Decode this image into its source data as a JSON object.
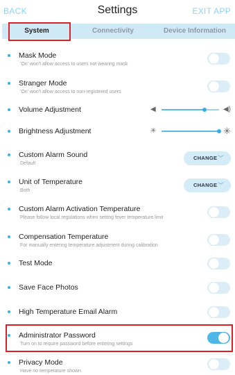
{
  "header": {
    "back": "BACK",
    "title": "Settings",
    "exit": "EXIT APP"
  },
  "tabs": [
    {
      "label": "System",
      "active": true
    },
    {
      "label": "Connectivity",
      "active": false
    },
    {
      "label": "Device Information",
      "active": false
    }
  ],
  "settings": {
    "mask_mode": {
      "label": "Mask Mode",
      "sub": "'On' won't allow access to users not wearing mask",
      "on": false
    },
    "stranger_mode": {
      "label": "Stranger Mode",
      "sub": "'On' won't allow access to non-registered users",
      "on": false
    },
    "volume": {
      "label": "Volume Adjustment",
      "value_percent": 75
    },
    "brightness": {
      "label": "Brightness Adjustment",
      "value_percent": 100
    },
    "alarm_sound": {
      "label": "Custom Alarm Sound",
      "sub": "Default",
      "button": "CHANGE"
    },
    "temp_unit": {
      "label": "Unit of Temperature",
      "sub": "Both",
      "button": "CHANGE"
    },
    "alarm_temp": {
      "label": "Custom Alarm Activation Temperature",
      "sub": "Please follow local regulations when setting fever temperature limit",
      "on": false
    },
    "compensation": {
      "label": "Compensation Temperature",
      "sub": "For manually entering temperature adjustment during calibration",
      "on": false
    },
    "test_mode": {
      "label": "Test Mode",
      "on": false
    },
    "save_face": {
      "label": "Save Face Photos",
      "on": false
    },
    "email_alarm": {
      "label": "High Temperature Email Alarm",
      "on": false
    },
    "admin_password": {
      "label": "Administrator Password",
      "sub": "Turn on to require password before entering settings",
      "on": true
    },
    "privacy_mode": {
      "label": "Privacy Mode",
      "sub": "Have no temperature shown.",
      "on": false
    }
  },
  "icons": {
    "volume_low": "speaker-low-icon",
    "volume_high": "speaker-high-icon",
    "brightness_low": "sun-low-icon",
    "brightness_high": "sun-high-icon",
    "chevron": "chevron-down-icon"
  },
  "colors": {
    "accent": "#4fb7e8",
    "tab_bar": "#cfe9f7",
    "highlight": "#d92027",
    "link": "#8fd3f2"
  }
}
